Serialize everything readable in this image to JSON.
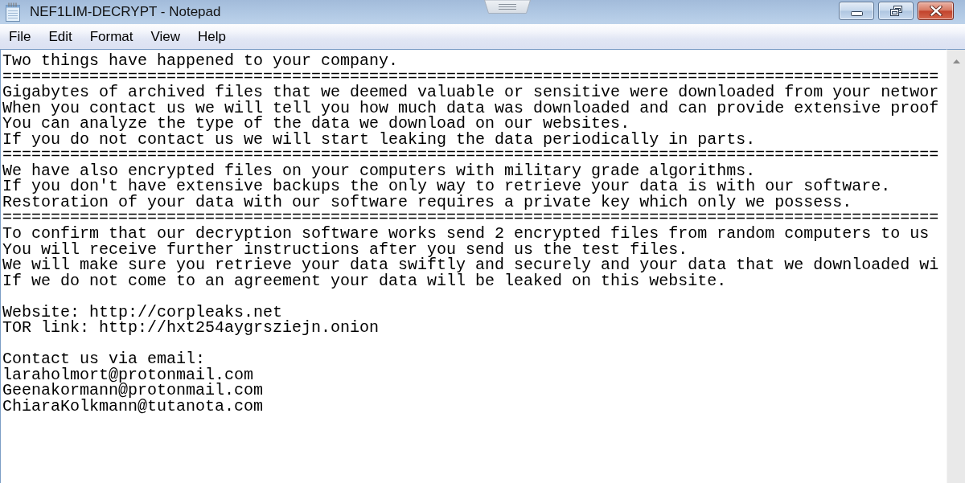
{
  "window": {
    "title": "NEF1LIM-DECRYPT - Notepad"
  },
  "menu_bar": {
    "items": [
      "File",
      "Edit",
      "Format",
      "View",
      "Help"
    ]
  },
  "editor": {
    "blocks": [
      {
        "lines": [
          "Two things have happened to your company.",
          "=================================================================================================",
          "Gigabytes of archived files that we deemed valuable or sensitive were downloaded from your networ",
          "When you contact us we will tell you how much data was downloaded and can provide extensive proof",
          "You can analyze the type of the data we download on our websites.",
          "If you do not contact us we will start leaking the data periodically in parts.",
          "=================================================================================================",
          "We have also encrypted files on your computers with military grade algorithms.",
          "If you don't have extensive backups the only way to retrieve your data is with our software.",
          "Restoration of your data with our software requires a private key which only we possess.",
          "=================================================================================================",
          "To confirm that our decryption software works send 2 encrypted files from random computers to us",
          "You will receive further instructions after you send us the test files.",
          "We will make sure you retrieve your data swiftly and securely and your data that we downloaded wi",
          "If we do not come to an agreement your data will be leaked on this website."
        ]
      },
      {
        "lines": [
          "Website: http://corpleaks.net",
          "TOR link: http://hxt254aygrsziejn.onion"
        ]
      },
      {
        "lines": [
          "Contact us via email:",
          "laraholmort@protonmail.com",
          "Geenakormann@protonmail.com",
          "ChiaraKolkmann@tutanota.com"
        ]
      }
    ]
  }
}
